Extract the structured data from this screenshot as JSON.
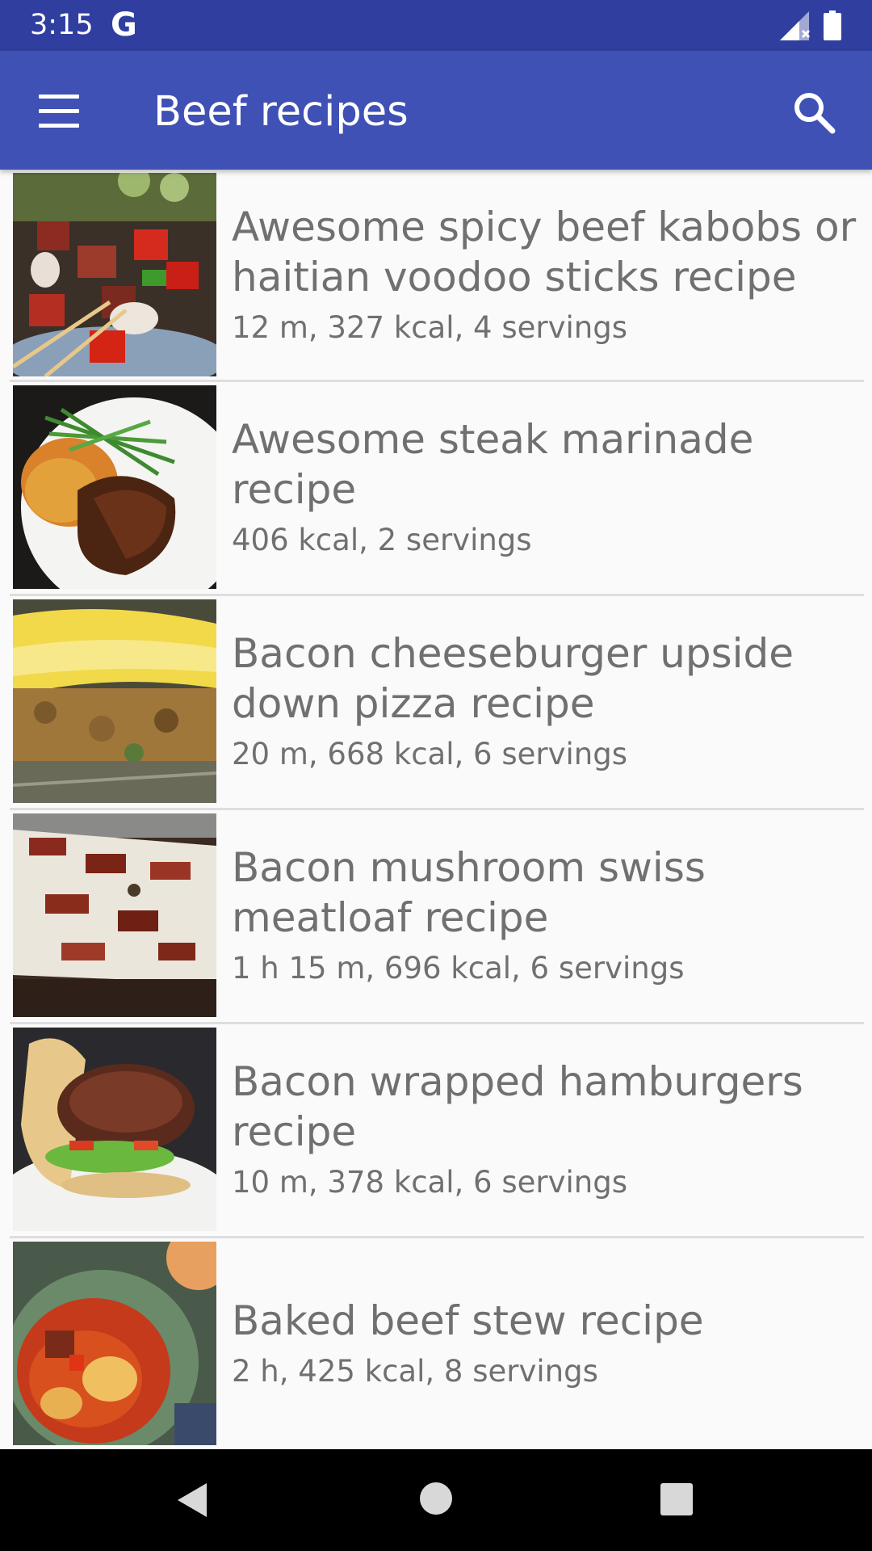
{
  "status_bar": {
    "time": "3:15",
    "g_icon": "G",
    "icons": [
      "signal-icon",
      "battery-icon"
    ]
  },
  "app_bar": {
    "title": "Beef recipes",
    "menu_icon": "menu-icon",
    "search_icon": "search-icon"
  },
  "recipes": [
    {
      "title": "Awesome spicy beef kabobs or haitian voodoo sticks recipe",
      "meta": "12 m, 327 kcal, 4 servings"
    },
    {
      "title": "Awesome steak marinade recipe",
      "meta": "406 kcal, 2 servings"
    },
    {
      "title": "Bacon cheeseburger upside down pizza recipe",
      "meta": "20 m, 668 kcal, 6 servings"
    },
    {
      "title": "Bacon mushroom swiss meatloaf recipe",
      "meta": "1 h 15 m, 696 kcal, 6 servings"
    },
    {
      "title": "Bacon wrapped hamburgers recipe",
      "meta": "10 m, 378 kcal, 6 servings"
    },
    {
      "title": "Baked beef stew recipe",
      "meta": "2 h, 425 kcal, 8 servings"
    }
  ],
  "nav_bar": {
    "icons": [
      "back-icon",
      "home-icon",
      "recents-icon"
    ]
  },
  "colors": {
    "status_bar": "#303f9f",
    "app_bar": "#3f51b5",
    "list_background": "#fafafa",
    "text": "#707070"
  }
}
